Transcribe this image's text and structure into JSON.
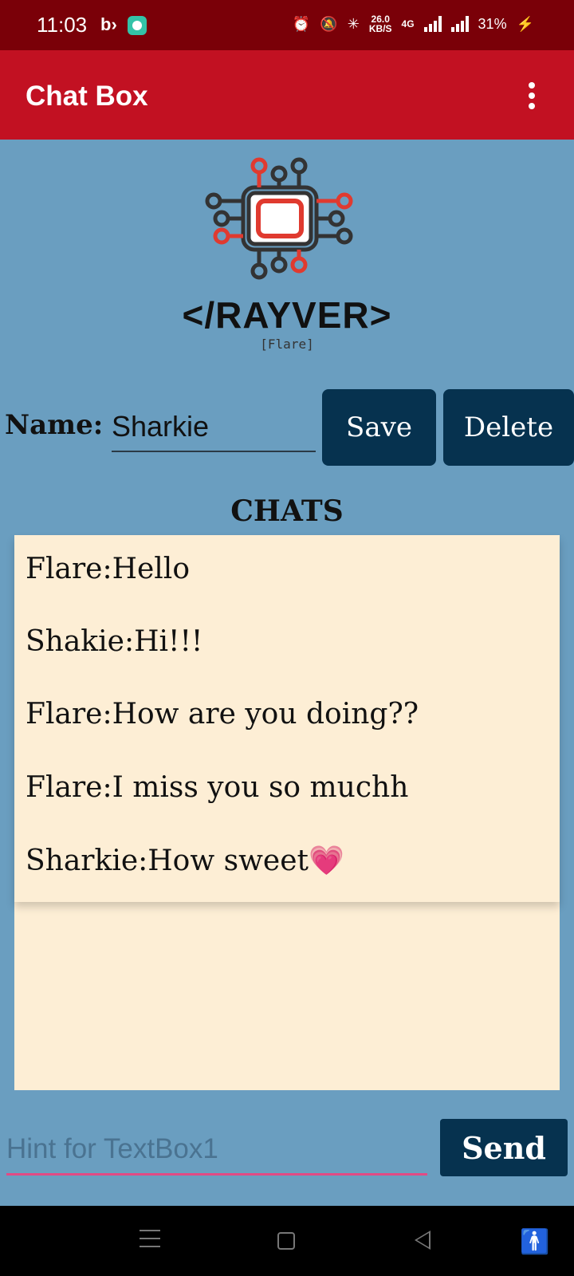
{
  "status_bar": {
    "time": "11:03",
    "speed_value": "26.0",
    "speed_unit": "KB/S",
    "network": "4G",
    "battery": "31%"
  },
  "app_bar": {
    "title": "Chat Box"
  },
  "logo": {
    "brand": "</RAYVER>",
    "subtitle": "[Flare]"
  },
  "name_section": {
    "label": "Name:",
    "value": "Sharkie",
    "save_label": "Save",
    "delete_label": "Delete"
  },
  "chats": {
    "title": "CHATS",
    "messages": [
      "Flare:Hello",
      "Shakie:Hi!!!",
      "Flare:How are you doing??",
      "Flare:I miss you so muchh",
      "Sharkie:How sweet💗"
    ]
  },
  "compose": {
    "placeholder": "Hint for TextBox1",
    "value": "",
    "send_label": "Send"
  },
  "colors": {
    "status_bar": "#7a0008",
    "app_bar": "#c21122",
    "background": "#6a9ec0",
    "button": "#06324f",
    "chat_panel": "#fdeed5",
    "input_underline": "#e24a84"
  }
}
